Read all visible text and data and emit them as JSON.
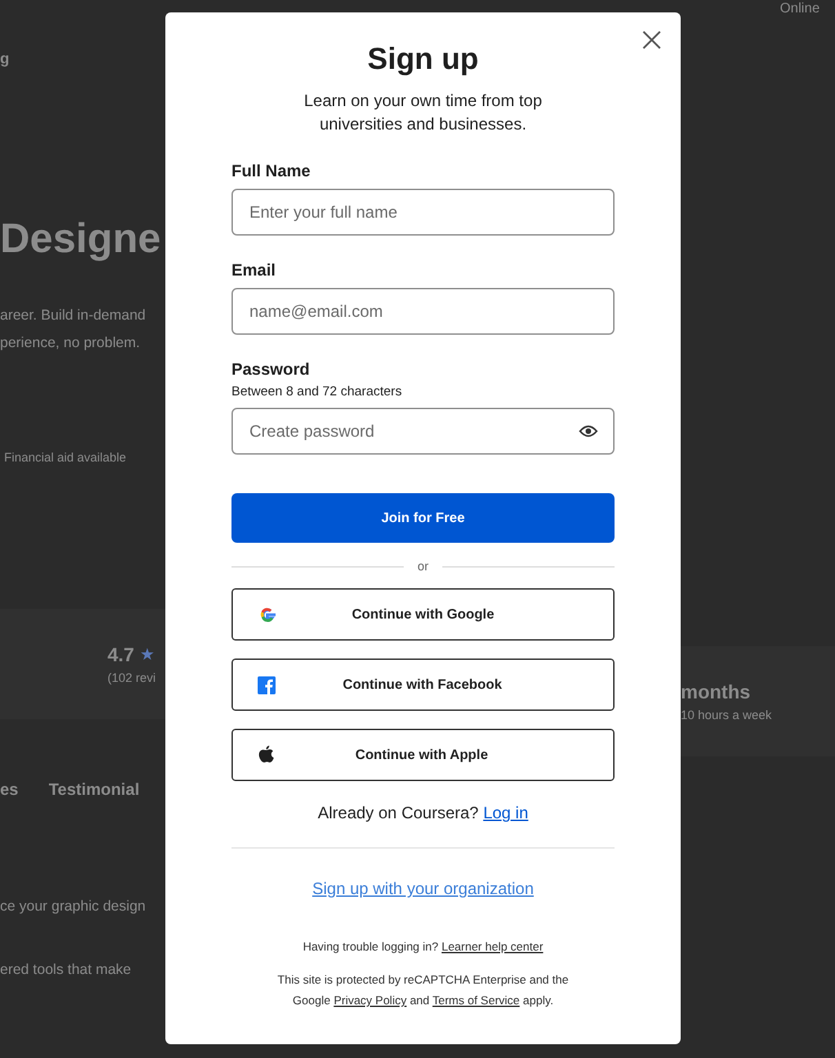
{
  "background": {
    "top_right": "Online",
    "nav_fragment": "g",
    "heading": "Designe",
    "description_lines": [
      "areer. Build in-demand",
      "perience, no problem."
    ],
    "financial_aid": "Financial aid available",
    "rating": {
      "value": "4.7",
      "star": "★",
      "reviews": "(102 revi"
    },
    "duration": {
      "value": "months",
      "detail": "10 hours a week"
    },
    "tabs": [
      {
        "label": "es"
      },
      {
        "label": "Testimonial"
      }
    ],
    "body_lines": [
      "ce your graphic design",
      "ered tools that make"
    ]
  },
  "modal": {
    "title": "Sign up",
    "subtitle": "Learn on your own time from top universities and businesses.",
    "fields": [
      {
        "kind": "text",
        "label": "Full Name",
        "placeholder": "Enter your full name"
      },
      {
        "kind": "text",
        "label": "Email",
        "placeholder": "name@email.com"
      },
      {
        "kind": "password",
        "label": "Password",
        "hint": "Between 8 and 72 characters",
        "placeholder": "Create password"
      }
    ],
    "primary_button": "Join for Free",
    "divider_text": "or",
    "social_buttons": [
      {
        "kind": "google",
        "label": "Continue with Google"
      },
      {
        "kind": "facebook",
        "label": "Continue with Facebook"
      },
      {
        "kind": "apple",
        "label": "Continue with Apple"
      }
    ],
    "login_prompt": {
      "text": "Already on Coursera?",
      "link": "Log in"
    },
    "org_link": "Sign up with your organization",
    "help": {
      "text": "Having trouble logging in?",
      "link": "Learner help center"
    },
    "legal": {
      "before": "This site is protected by reCAPTCHA Enterprise and the Google",
      "privacy_link": "Privacy Policy",
      "middle": "and",
      "terms_link": "Terms of Service",
      "after": "apply."
    }
  }
}
